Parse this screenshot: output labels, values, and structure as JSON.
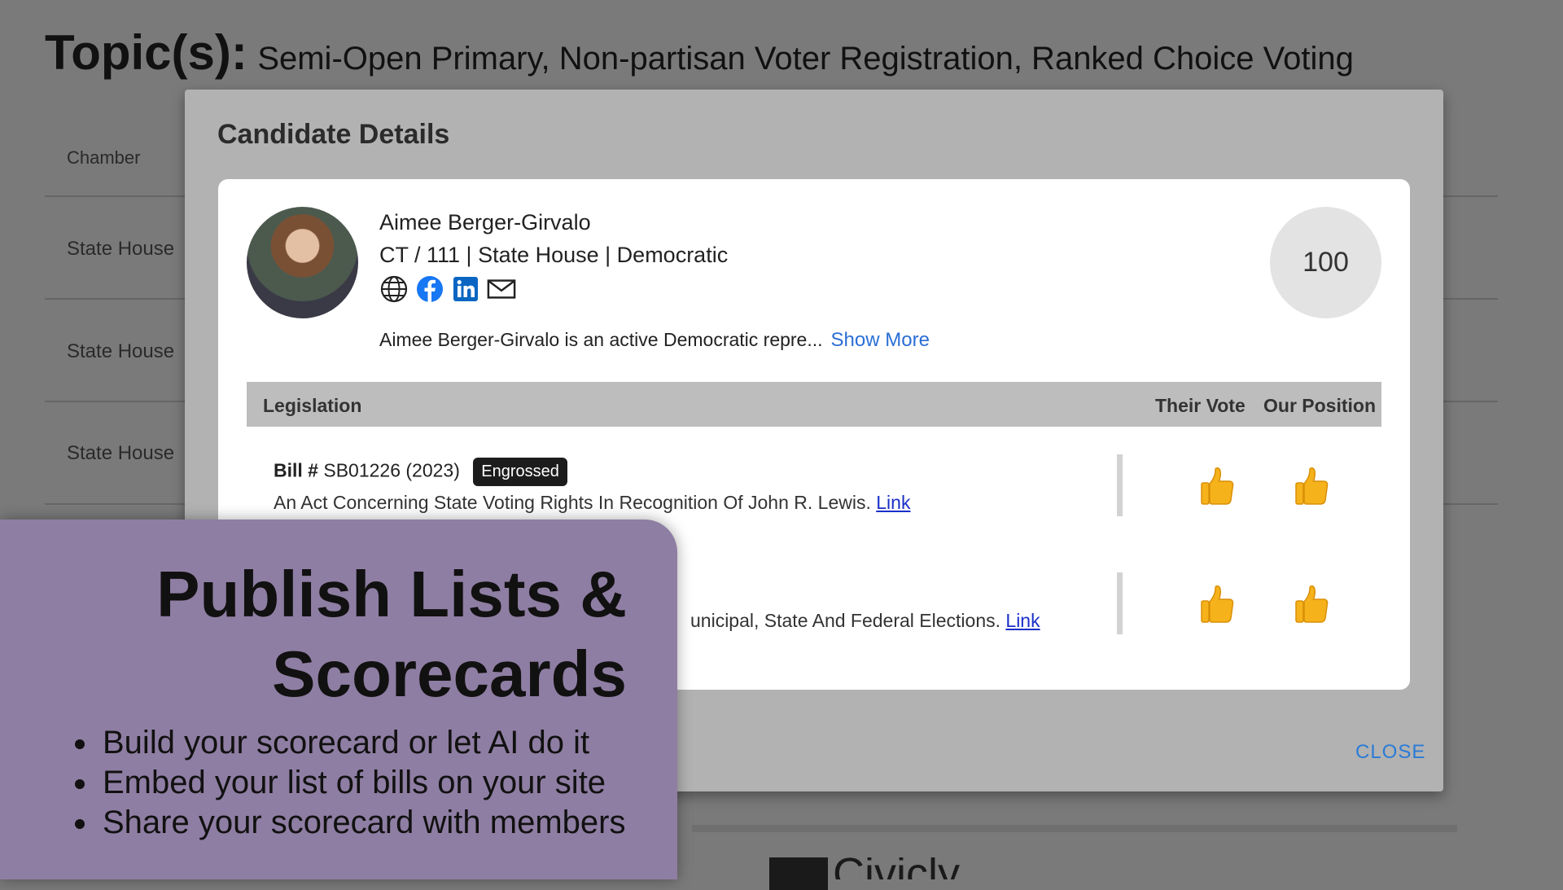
{
  "background": {
    "topic_label": "Topic(s):",
    "topic_values": "Semi-Open Primary, Non-partisan Voter Registration, Ranked Choice Voting",
    "column_chamber": "Chamber",
    "rows": [
      "State House",
      "State House",
      "State House"
    ],
    "logo_text": "Civicly"
  },
  "modal": {
    "title": "Candidate Details",
    "candidate": {
      "name": "Aimee Berger-Girvalo",
      "meta": "CT / 111 | State House | Democratic",
      "socials": [
        "globe-icon",
        "facebook-icon",
        "linkedin-icon",
        "email-icon"
      ],
      "bio": "Aimee Berger-Girvalo is an active Democratic repre...",
      "show_more": "Show More",
      "score": "100"
    },
    "legislation": {
      "header": {
        "legislation": "Legislation",
        "their_vote": "Their Vote",
        "our_position": "Our Position"
      },
      "bills": [
        {
          "bill_label": "Bill #",
          "bill_id": "SB01226 (2023)",
          "badge": "Engrossed",
          "description": "An Act Concerning State Voting Rights In Recognition Of John R. Lewis.",
          "link": "Link",
          "their_vote": "thumbs-up",
          "our_position": "thumbs-up"
        },
        {
          "description": "unicipal, State And Federal Elections.",
          "link": "Link",
          "their_vote": "thumbs-up",
          "our_position": "thumbs-up"
        }
      ]
    },
    "close": "CLOSE"
  },
  "promo": {
    "title_line1": "Publish Lists &",
    "title_line2": "Scorecards",
    "bullets": [
      "Build your scorecard or let AI do it",
      "Embed your list of bills on your site",
      "Share your scorecard with members"
    ]
  },
  "colors": {
    "promo_bg": "#8f7ea3",
    "link": "#1a2fc9",
    "accent_blue": "#2a7bd6",
    "badge_bg": "#1c1c1c"
  }
}
